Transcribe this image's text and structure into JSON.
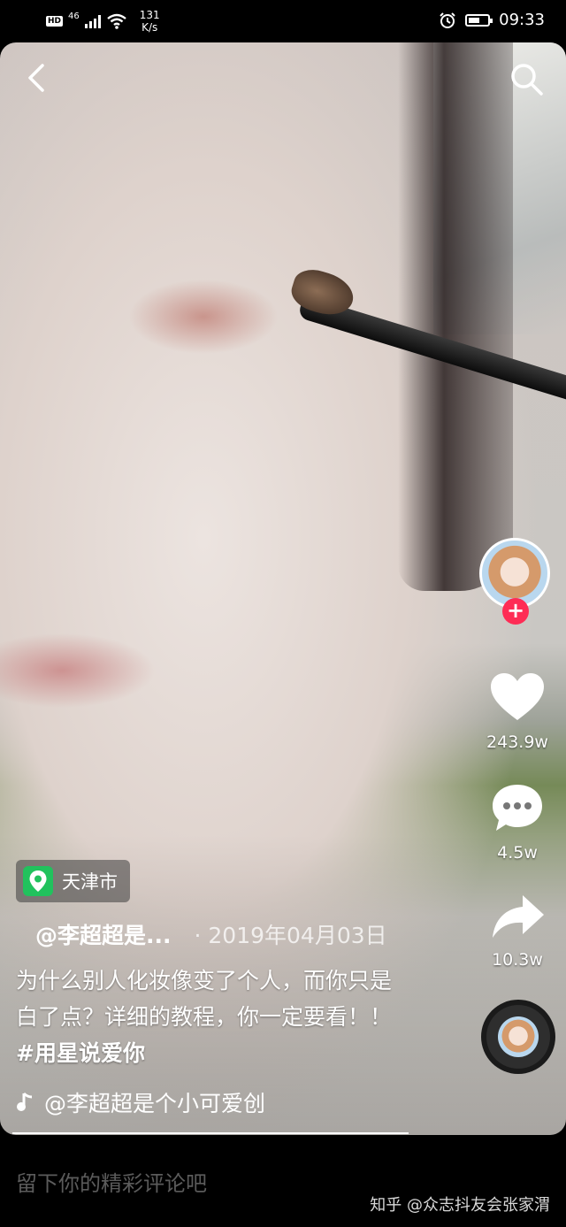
{
  "status_bar": {
    "network_badge": "HD",
    "network_type": "46",
    "speed_value": "131",
    "speed_unit": "K/s",
    "time": "09:33"
  },
  "video": {
    "location": "天津市",
    "author": "@李超超是...",
    "date": "· 2019年04月03日",
    "caption": "为什么别人化妆像变了个人，而你只是白了点？详细的教程，你一定要看！！",
    "hashtag": "#用星说爱你",
    "music": "@李超超是个小可爱创"
  },
  "actions": {
    "likes": "243.9w",
    "comments": "4.5w",
    "shares": "10.3w"
  },
  "comment_placeholder": "留下你的精彩评论吧",
  "watermark": "知乎 @众志抖友会张家渭",
  "colors": {
    "follow_accent": "#fe2c55",
    "location_pin": "#21c25d"
  }
}
